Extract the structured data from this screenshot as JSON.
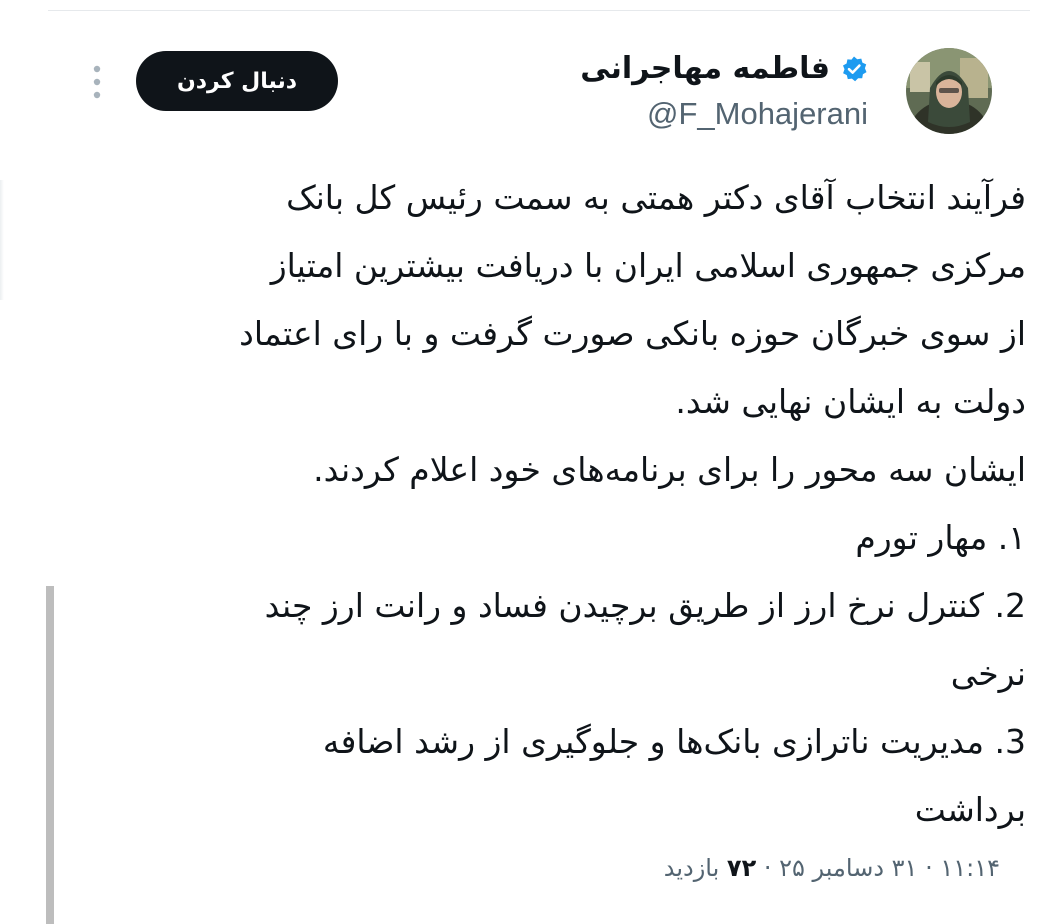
{
  "author": {
    "display_name": "فاطمه مهاجرانی",
    "handle": "@F_Mohajerani",
    "verified": true
  },
  "actions": {
    "follow_label": "دنبال کردن",
    "more_icon": "more-vertical-icon"
  },
  "tweet": {
    "lines": [
      "فرآیند انتخاب آقای دکتر همتی به سمت رئیس کل بانک",
      "مرکزی جمهوری اسلامی ایران با دریافت بیشترین امتیاز",
      "از سوی خبرگان حوزه بانکی صورت گرفت و با رای اعتماد",
      "دولت به ایشان نهایی شد.",
      "ایشان سه محور را برای برنامه‌های خود اعلام کردند.",
      "۱. مهار تورم",
      "2. کنترل نرخ ارز از طریق برچیدن فساد و رانت ارز چند",
      "نرخی",
      "3. مدیریت ناترازی بانک‌ها و جلوگیری از رشد اضافه",
      "برداشت"
    ]
  },
  "meta": {
    "time": "۱۱:۱۴",
    "separator": "·",
    "date": "۳۱ دسامبر ۲۵",
    "views_count": "۷۲",
    "views_label": "بازدید"
  },
  "colors": {
    "text_primary": "#0f1419",
    "text_secondary": "#536471",
    "verified_blue": "#1d9bf0",
    "button_bg": "#0f1419"
  }
}
